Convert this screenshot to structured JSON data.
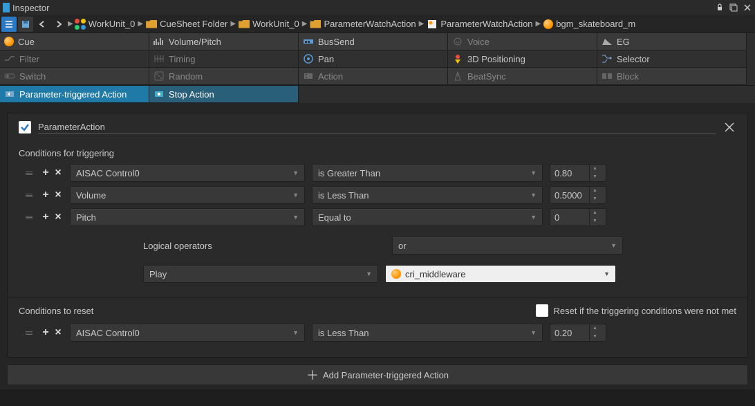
{
  "window": {
    "title": "Inspector"
  },
  "breadcrumb": {
    "items": [
      {
        "icon": "clover",
        "label": "WorkUnit_0"
      },
      {
        "icon": "folder",
        "label": "CueSheet Folder"
      },
      {
        "icon": "folder",
        "label": "WorkUnit_0"
      },
      {
        "icon": "folder",
        "label": "ParameterWatchAction"
      },
      {
        "icon": "sheet",
        "label": "ParameterWatchAction"
      },
      {
        "icon": "cue",
        "label": "bgm_skateboard_m"
      }
    ]
  },
  "tabs": {
    "row1": [
      {
        "label": "Cue",
        "icon": "cue-orange",
        "muted": false
      },
      {
        "label": "Volume/Pitch",
        "icon": "vol",
        "muted": false
      },
      {
        "label": "BusSend",
        "icon": "bus",
        "muted": false
      },
      {
        "label": "Voice",
        "icon": "voice",
        "muted": true
      },
      {
        "label": "EG",
        "icon": "eg",
        "muted": false
      }
    ],
    "row2": [
      {
        "label": "Filter",
        "icon": "filter",
        "muted": true
      },
      {
        "label": "Timing",
        "icon": "timing",
        "muted": true
      },
      {
        "label": "Pan",
        "icon": "pan",
        "muted": false
      },
      {
        "label": "3D Positioning",
        "icon": "3d",
        "muted": false
      },
      {
        "label": "Selector",
        "icon": "selector",
        "muted": false
      }
    ],
    "row3": [
      {
        "label": "Switch",
        "icon": "switch",
        "muted": true
      },
      {
        "label": "Random",
        "icon": "random",
        "muted": true
      },
      {
        "label": "Action",
        "icon": "action",
        "muted": true
      },
      {
        "label": "BeatSync",
        "icon": "beat",
        "muted": true
      },
      {
        "label": "Block",
        "icon": "block",
        "muted": true
      }
    ],
    "row4": [
      {
        "label": "Parameter-triggered Action",
        "active": true
      },
      {
        "label": "Stop Action",
        "sub_active": true
      }
    ]
  },
  "panel": {
    "title": "ParameterAction",
    "section1_title": "Conditions for triggering",
    "conditions": [
      {
        "param": "AISAC Control0",
        "op": "is Greater Than",
        "value": "0.80"
      },
      {
        "param": "Volume",
        "op": "is Less Than",
        "value": "0.5000"
      },
      {
        "param": "Pitch",
        "op": "Equal to",
        "value": "0"
      }
    ],
    "logical_operators_label": "Logical operators",
    "logical_operator": "or",
    "action_type": "Play",
    "action_target": "cri_middleware",
    "section2_title": "Conditions to reset",
    "reset_checkbox_label": "Reset if the triggering conditions were not met",
    "reset_conditions": [
      {
        "param": "AISAC Control0",
        "op": "is Less Than",
        "value": "0.20"
      }
    ],
    "add_button": "Add Parameter-triggered Action"
  }
}
